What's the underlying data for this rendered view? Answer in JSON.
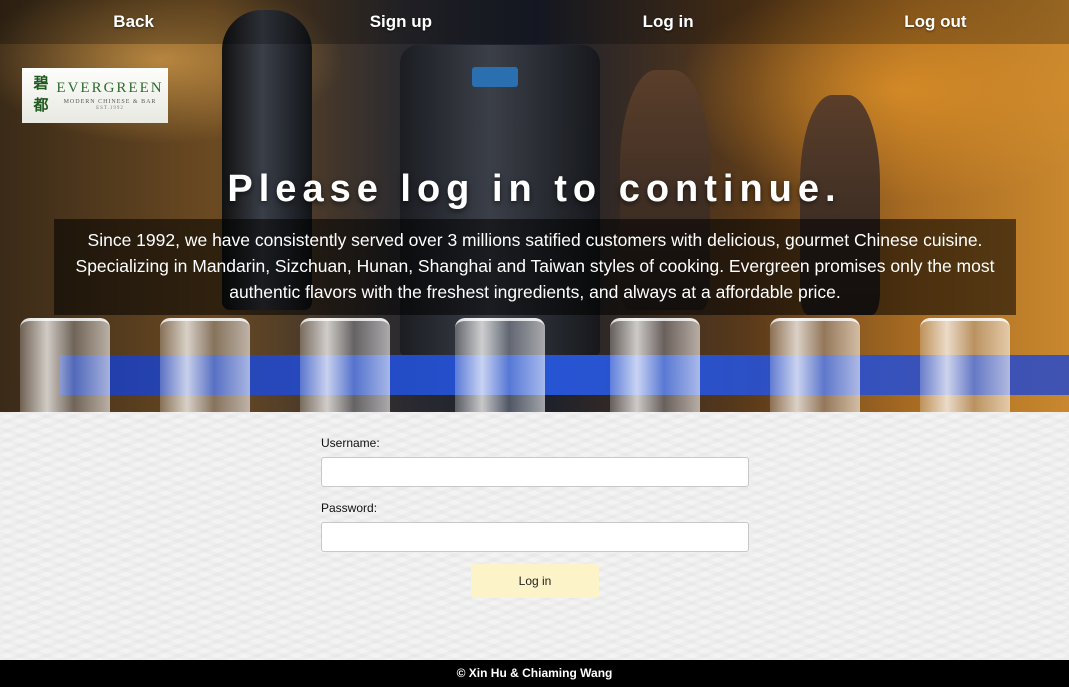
{
  "nav": {
    "back": "Back",
    "signup": "Sign up",
    "login": "Log in",
    "logout": "Log out"
  },
  "logo": {
    "name": "EVERGREEN",
    "subtitle": "MODERN CHINESE & BAR",
    "established": "EST.1992",
    "chinese": "碧 都"
  },
  "hero": {
    "headline": "Please log in to continue.",
    "intro": "Since 1992, we have consistently served over 3 millions satified customers with delicious, gourmet Chinese cuisine. Specializing in Mandarin, Sizchuan, Hunan, Shanghai and Taiwan styles of cooking. Evergreen promises only the most authentic flavors with the freshest ingredients, and always at a affordable price."
  },
  "form": {
    "username_label": "Username:",
    "username_value": "",
    "password_label": "Password:",
    "password_value": "",
    "submit_label": "Log in"
  },
  "footer": {
    "credit": "© Xin Hu & Chiaming Wang"
  }
}
